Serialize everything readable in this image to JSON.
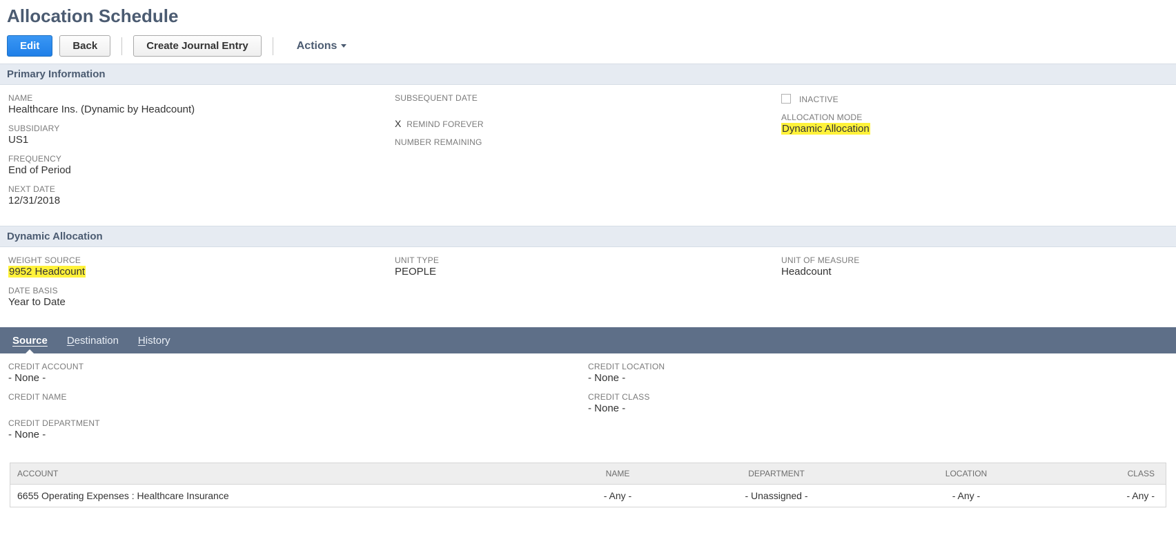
{
  "page": {
    "title": "Allocation Schedule"
  },
  "toolbar": {
    "edit": "Edit",
    "back": "Back",
    "create_je": "Create Journal Entry",
    "actions": "Actions"
  },
  "sections": {
    "primary": {
      "title": "Primary Information",
      "name_label": "NAME",
      "name_value": "Healthcare Ins. (Dynamic by Headcount)",
      "subsidiary_label": "SUBSIDIARY",
      "subsidiary_value": "US1",
      "frequency_label": "FREQUENCY",
      "frequency_value": "End of Period",
      "next_date_label": "NEXT DATE",
      "next_date_value": "12/31/2018",
      "subsequent_date_label": "SUBSEQUENT DATE",
      "remind_forever_label": "REMIND FOREVER",
      "remind_forever_mark": "X",
      "number_remaining_label": "NUMBER REMAINING",
      "inactive_label": "INACTIVE",
      "allocation_mode_label": "ALLOCATION MODE",
      "allocation_mode_value": "Dynamic Allocation"
    },
    "dynamic": {
      "title": "Dynamic Allocation",
      "weight_source_label": "WEIGHT SOURCE",
      "weight_source_value": "9952 Headcount",
      "date_basis_label": "DATE BASIS",
      "date_basis_value": "Year to Date",
      "unit_type_label": "UNIT TYPE",
      "unit_type_value": "PEOPLE",
      "uom_label": "UNIT OF MEASURE",
      "uom_value": "Headcount"
    }
  },
  "tabs": {
    "source_label": "Source",
    "source_html": "Source",
    "destination_html": "Destination",
    "history_html": "History"
  },
  "source": {
    "credit_account_label": "CREDIT ACCOUNT",
    "credit_account_value": "- None -",
    "credit_name_label": "CREDIT NAME",
    "credit_name_value": "",
    "credit_department_label": "CREDIT DEPARTMENT",
    "credit_department_value": "- None -",
    "credit_location_label": "CREDIT LOCATION",
    "credit_location_value": "- None -",
    "credit_class_label": "CREDIT CLASS",
    "credit_class_value": "- None -"
  },
  "table": {
    "headers": {
      "account": "ACCOUNT",
      "name": "NAME",
      "department": "DEPARTMENT",
      "location": "LOCATION",
      "class": "CLASS"
    },
    "rows": [
      {
        "account": "6655 Operating Expenses : Healthcare Insurance",
        "name": "- Any -",
        "department": "- Unassigned -",
        "location": "- Any -",
        "class": "- Any -"
      }
    ]
  }
}
